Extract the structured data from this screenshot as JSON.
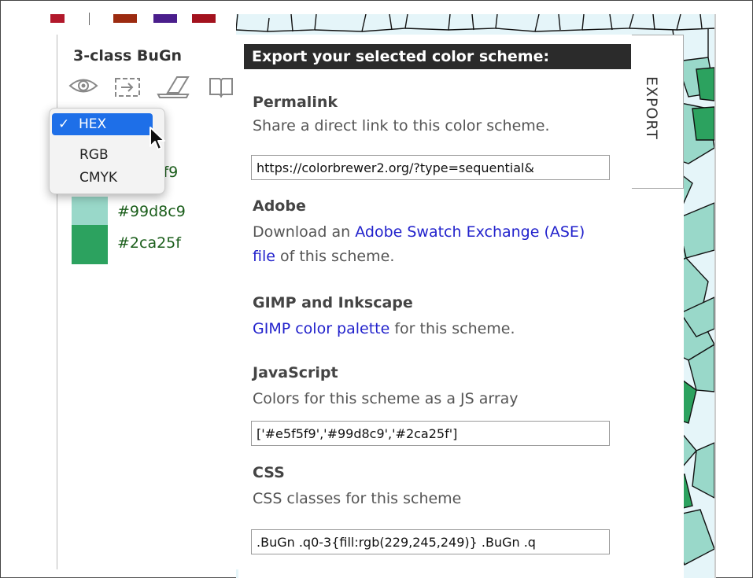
{
  "top_swatches": [
    "#b2182b",
    "#9c2b10",
    "#4a1e8c",
    "#a3121e"
  ],
  "scheme": {
    "title": "3-class BuGn",
    "colors": [
      {
        "hex": "#e5f5f9",
        "label": "#e5f5f9"
      },
      {
        "hex": "#99d8c9",
        "label": "#99d8c9"
      },
      {
        "hex": "#2ca25f",
        "label": "#2ca25f"
      }
    ],
    "partial_label_visible": "5f9"
  },
  "icons": [
    "eye-icon",
    "export-icon",
    "laptop-icon",
    "book-icon"
  ],
  "format_dropdown": {
    "options": [
      "HEX",
      "RGB",
      "CMYK"
    ],
    "selected": "HEX",
    "check_mark": "✓"
  },
  "export": {
    "header": "Export your selected color scheme:",
    "tab_label": "EXPORT",
    "permalink": {
      "title": "Permalink",
      "desc": "Share a direct link to this color scheme.",
      "value": "https://colorbrewer2.org/?type=sequential&"
    },
    "adobe": {
      "title": "Adobe",
      "desc_before": "Download an ",
      "link": "Adobe Swatch Exchange (ASE) file",
      "desc_after": " of this scheme."
    },
    "gimp": {
      "title": "GIMP and Inkscape",
      "link": "GIMP color palette",
      "desc_after": " for this scheme."
    },
    "javascript": {
      "title": "JavaScript",
      "desc": "Colors for this scheme as a JS array",
      "value": "['#e5f5f9','#99d8c9','#2ca25f']"
    },
    "css": {
      "title": "CSS",
      "desc": "CSS classes for this scheme",
      "value": ".BuGn .q0-3{fill:rgb(229,245,249)} .BuGn .q"
    }
  }
}
